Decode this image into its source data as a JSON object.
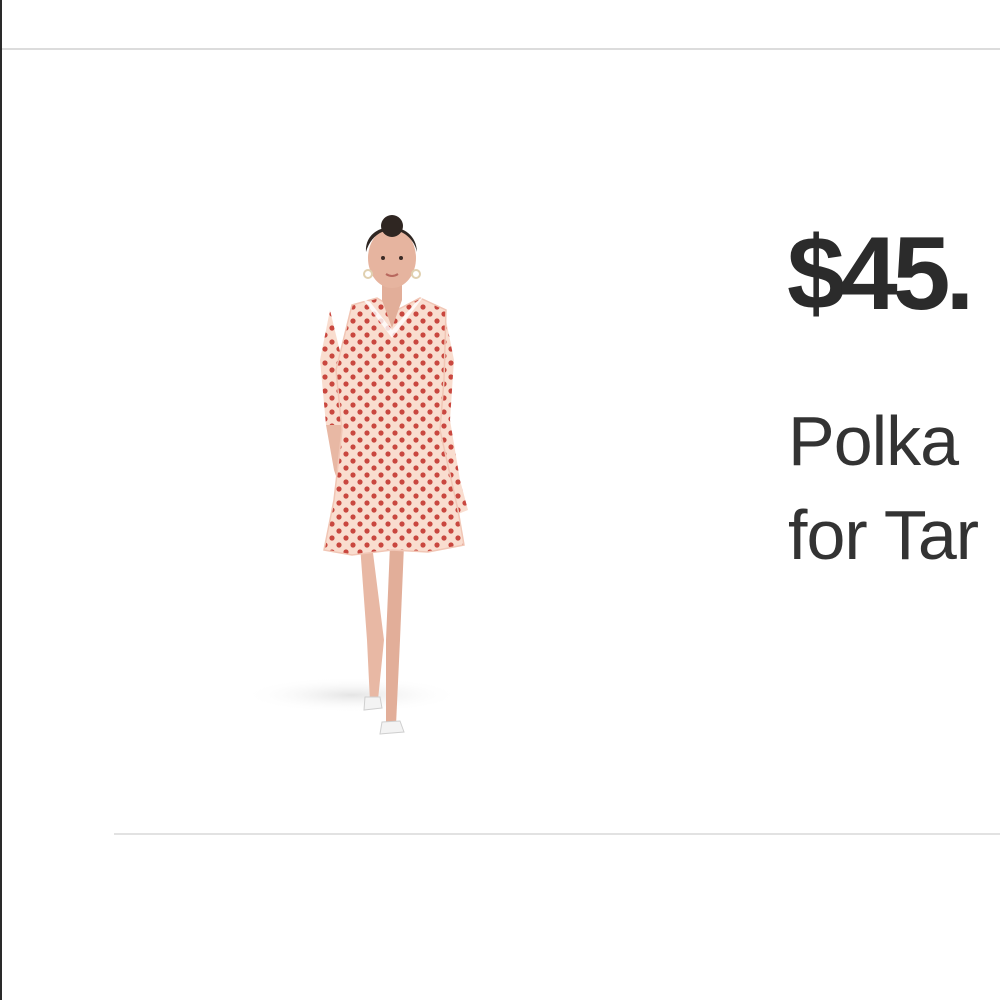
{
  "product": {
    "price": "$45.",
    "title_line1": "Polka",
    "title_line2": "for Tar",
    "image_icon": "model-wearing-polka-dot-dress-photo"
  },
  "colors": {
    "dress": "#f9ddcf",
    "dots": "#c9473f",
    "text": "#2b2b2b",
    "divider": "#dcdcdc"
  }
}
